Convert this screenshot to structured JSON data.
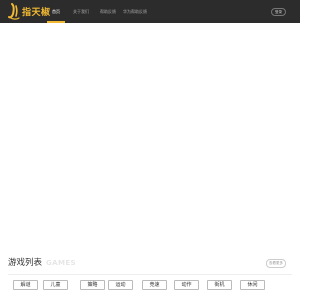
{
  "header": {
    "brand": "指天椒",
    "nav": [
      {
        "label": "首页",
        "active": true
      },
      {
        "label": "关于我们",
        "active": false
      },
      {
        "label": "帮助反馈",
        "active": false
      },
      {
        "label": "华为帮助反馈",
        "active": false
      }
    ],
    "login_label": "登录",
    "brand_color": "#f0b833",
    "bar_color": "#2c2c2c"
  },
  "games_section": {
    "title": "游戏列表",
    "title_en": "GAMES",
    "more_label": "查看更多",
    "categories": [
      "解谜",
      "儿童",
      "策略",
      "运动",
      "竞速",
      "动作",
      "街机",
      "休闲"
    ]
  }
}
